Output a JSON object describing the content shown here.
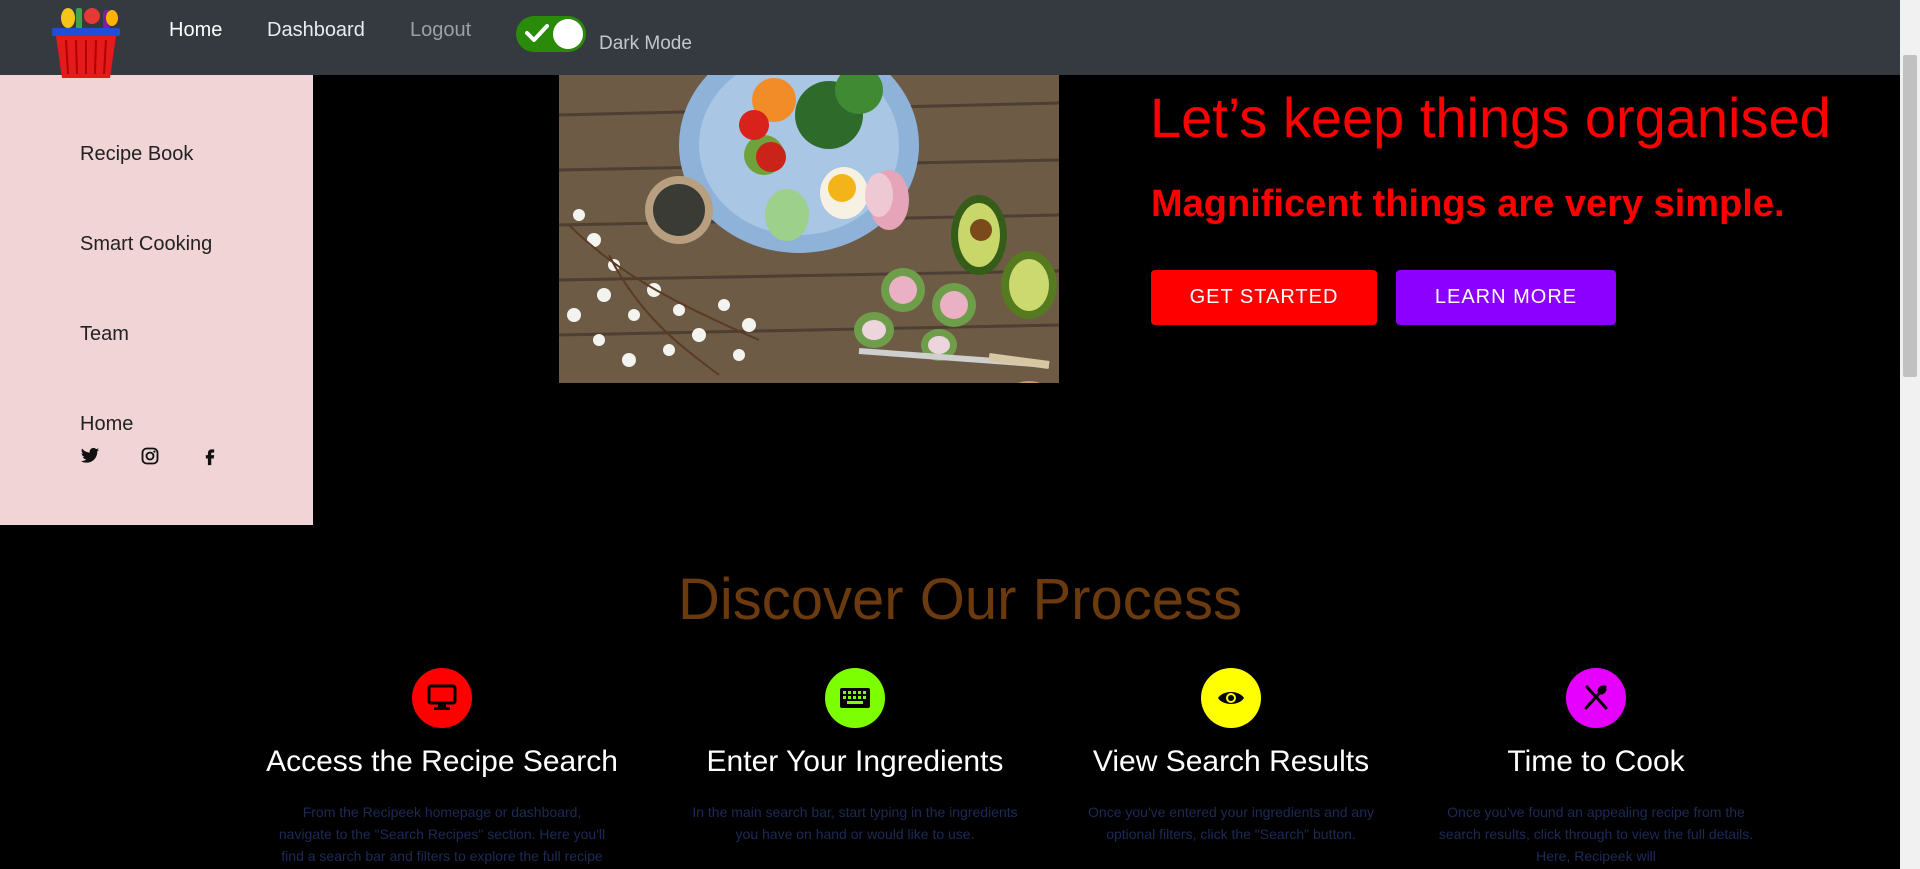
{
  "nav": {
    "home": "Home",
    "dashboard": "Dashboard",
    "logout": "Logout",
    "dark_mode_label": "Dark Mode",
    "dark_mode_on": true
  },
  "sidebar": {
    "items": [
      {
        "label": "Recipe Book"
      },
      {
        "label": "Smart Cooking"
      },
      {
        "label": "Team"
      },
      {
        "label": "Home"
      }
    ],
    "social": [
      "twitter-icon",
      "instagram-icon",
      "facebook-icon"
    ]
  },
  "hero": {
    "title": "Let’s keep things organised",
    "subtitle": "Magnificent things are very simple.",
    "get_started": "GET STARTED",
    "learn_more": "LEARN MORE"
  },
  "process": {
    "title": "Discover Our Process",
    "steps": [
      {
        "icon": "monitor-icon",
        "color": "#ff0000",
        "title": "Access the Recipe Search",
        "text": "From the Recipeek homepage or dashboard, navigate to the \"Search Recipes\" section. Here you'll find a search bar and filters to explore the full recipe"
      },
      {
        "icon": "keyboard-icon",
        "color": "#7cff00",
        "title": "Enter Your Ingredients",
        "text": "In the main search bar, start typing in the ingredients you have on hand or would like to use."
      },
      {
        "icon": "eye-icon",
        "color": "#ffff00",
        "title": "View Search Results",
        "text": "Once you've entered your ingredients and any optional filters, click the \"Search\" button."
      },
      {
        "icon": "utensils-icon",
        "color": "#e600ff",
        "title": "Time to Cook",
        "text": "Once you've found an appealing recipe from the search results, click through to view the full details. Here, Recipeek will"
      }
    ]
  },
  "colors": {
    "navbar": "#343a40",
    "sidebar": "#f0d4d6",
    "hero_text": "#ff0000",
    "btn_start": "#ff0000",
    "btn_learn": "#8b00ff",
    "process_title": "#6b3a0f"
  }
}
